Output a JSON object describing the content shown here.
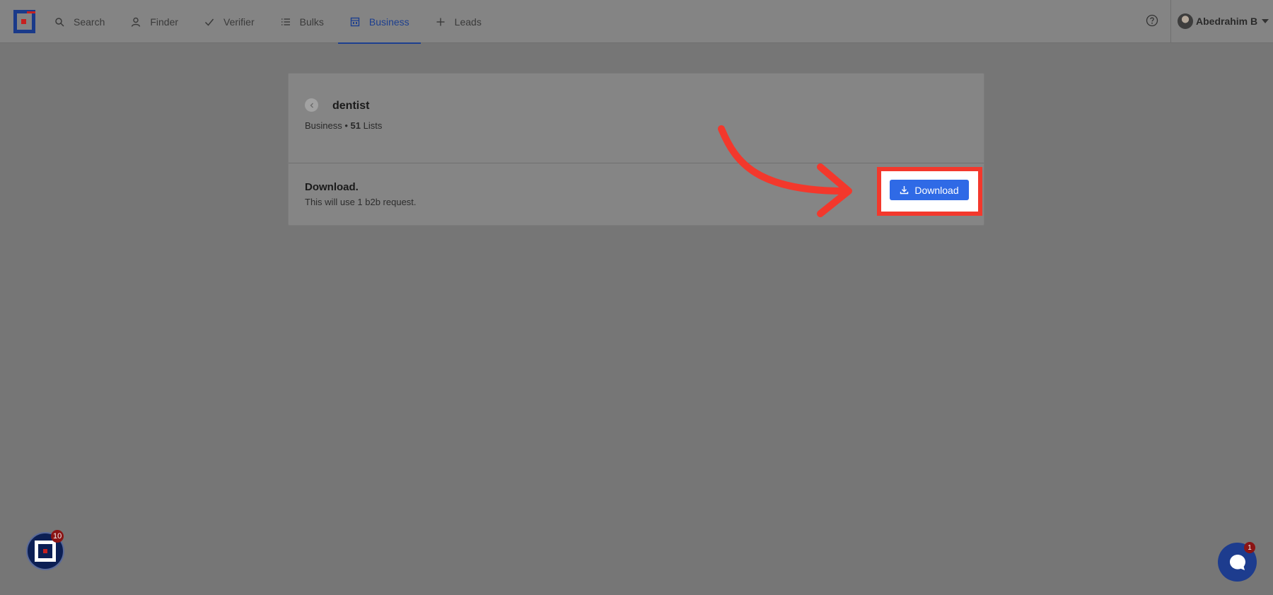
{
  "nav": {
    "items": [
      {
        "label": "Search",
        "icon": "search-icon"
      },
      {
        "label": "Finder",
        "icon": "user-icon"
      },
      {
        "label": "Verifier",
        "icon": "check-icon"
      },
      {
        "label": "Bulks",
        "icon": "list-icon"
      },
      {
        "label": "Business",
        "icon": "building-icon",
        "active": true
      },
      {
        "label": "Leads",
        "icon": "plus-icon"
      }
    ]
  },
  "user": {
    "name": "Abedrahim B"
  },
  "card": {
    "title": "dentist",
    "subtitle_prefix": "Business • ",
    "list_count": "51",
    "subtitle_suffix": " Lists",
    "download_title": "Download.",
    "download_desc": "This will use 1 b2b request.",
    "download_button": "Download"
  },
  "badges": {
    "notifications": "10",
    "chat": "1"
  },
  "colors": {
    "accent": "#1d3f8f",
    "button": "#2f6ae6",
    "highlight": "#f3382c"
  }
}
